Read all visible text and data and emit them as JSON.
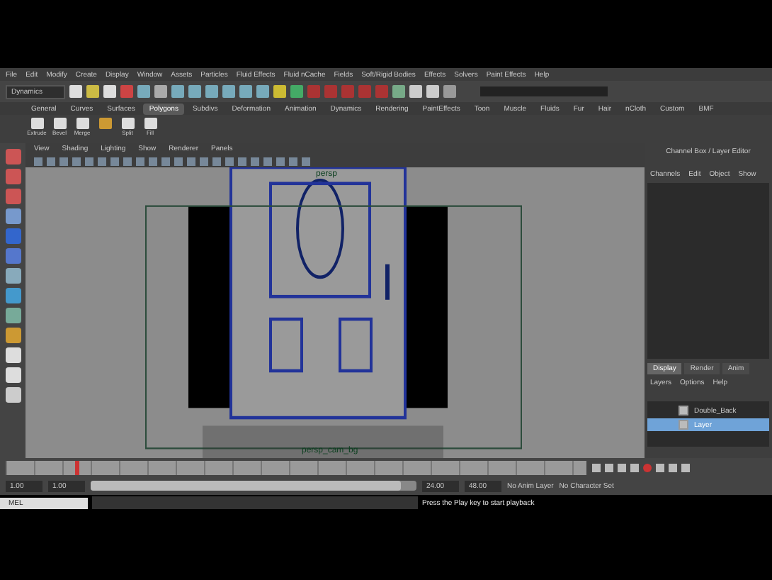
{
  "menu_bar": [
    "File",
    "Edit",
    "Modify",
    "Create",
    "Display",
    "Window",
    "Assets",
    "Particles",
    "Fluid Effects",
    "Fluid nCache",
    "Fields",
    "Soft/Rigid Bodies",
    "Effects",
    "Solvers",
    "Paint Effects",
    "Help"
  ],
  "status_line": {
    "menu_set": "Dynamics"
  },
  "shelf_tabs": [
    {
      "label": "General",
      "selected": false
    },
    {
      "label": "Curves",
      "selected": false
    },
    {
      "label": "Surfaces",
      "selected": false
    },
    {
      "label": "Polygons",
      "selected": true
    },
    {
      "label": "Subdivs",
      "selected": false
    },
    {
      "label": "Deformation",
      "selected": false
    },
    {
      "label": "Animation",
      "selected": false
    },
    {
      "label": "Dynamics",
      "selected": false
    },
    {
      "label": "Rendering",
      "selected": false
    },
    {
      "label": "PaintEffects",
      "selected": false
    },
    {
      "label": "Toon",
      "selected": false
    },
    {
      "label": "Muscle",
      "selected": false
    },
    {
      "label": "Fluids",
      "selected": false
    },
    {
      "label": "Fur",
      "selected": false
    },
    {
      "label": "Hair",
      "selected": false
    },
    {
      "label": "nCloth",
      "selected": false
    },
    {
      "label": "Custom",
      "selected": false
    },
    {
      "label": "BMF",
      "selected": false
    }
  ],
  "shelf_buttons": [
    {
      "kind": "labeled",
      "label": "Extrude"
    },
    {
      "kind": "labeled",
      "label": "Bevel"
    },
    {
      "kind": "labeled",
      "label": "Merge"
    },
    {
      "kind": "icon"
    },
    {
      "kind": "labeled",
      "label": "Split"
    },
    {
      "kind": "labeled",
      "label": "Fill"
    }
  ],
  "viewport": {
    "menus": [
      "View",
      "Shading",
      "Lighting",
      "Show",
      "Renderer",
      "Panels"
    ],
    "top_label": "persp",
    "camera_label": "persp_cam_bg"
  },
  "channel_box": {
    "title": "Channel Box / Layer Editor",
    "menus": [
      "Channels",
      "Edit",
      "Object",
      "Show"
    ]
  },
  "layer_editor": {
    "tabs": [
      {
        "label": "Display",
        "selected": true
      },
      {
        "label": "Render",
        "selected": false
      },
      {
        "label": "Anim",
        "selected": false
      }
    ],
    "menus": [
      "Layers",
      "Options",
      "Help"
    ],
    "layers": [
      {
        "name": "Double_Back",
        "visible": true,
        "selected": false
      },
      {
        "name": "Layer",
        "visible": true,
        "selected": true
      }
    ]
  },
  "time_slider": {
    "level": 0.12
  },
  "range": {
    "level": 0.95,
    "start": "1.00",
    "current": "1.00",
    "end": "24.00",
    "max": "48.00",
    "anim_layer": "No Anim Layer",
    "character_set": "No Character Set"
  },
  "command_line": {
    "language": "MEL",
    "result": "Press the Play key to start playback"
  }
}
